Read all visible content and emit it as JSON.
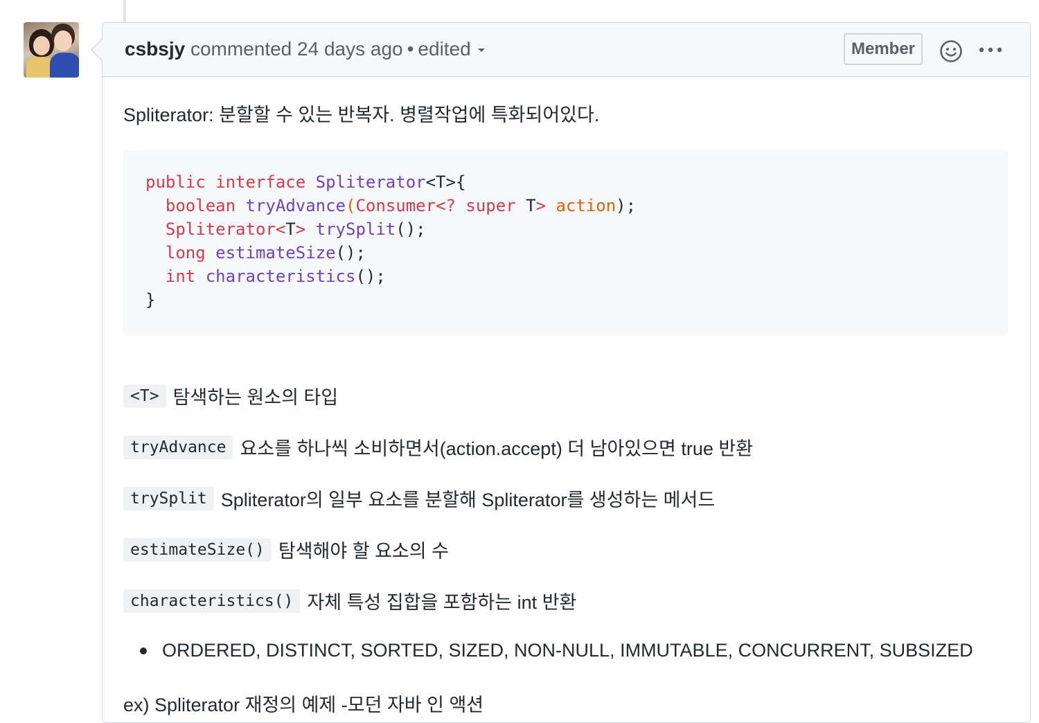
{
  "comment": {
    "author": "csbsjy",
    "action": "commented",
    "time": "24 days ago",
    "separator": "•",
    "edited": "edited",
    "badge": "Member"
  },
  "body": {
    "intro": "Spliterator: 분할할 수 있는 반복자. 병렬작업에 특화되어있다.",
    "code": {
      "line1": {
        "kw1": "public",
        "kw2": "interface",
        "name": "Spliterator",
        "rest": "<T>{"
      },
      "line2": {
        "kw": "boolean",
        "fn": "tryAdvance",
        "open": "(",
        "type": "Consumer<? super",
        "t": " T",
        "gt": ">",
        "param": "action",
        "close": ");"
      },
      "line3": {
        "kw": "Spliterator<",
        "t": "T",
        "gt": ">",
        "fn": "trySplit",
        "close": "();"
      },
      "line4": {
        "kw": "long",
        "fn": "estimateSize",
        "close": "();"
      },
      "line5": {
        "kw": "int",
        "fn": "characteristics",
        "close": "();"
      },
      "line6": "}"
    },
    "items": [
      {
        "code": "<T>",
        "text": "탐색하는 원소의 타입"
      },
      {
        "code": "tryAdvance",
        "text": "요소를 하나씩 소비하면서(action.accept) 더 남아있으면 true 반환"
      },
      {
        "code": "trySplit",
        "text": "Spliterator의 일부 요소를 분할해 Spliterator를 생성하는 메서드"
      },
      {
        "code": "estimateSize()",
        "text": "탐색해야 할 요소의 수"
      },
      {
        "code": "characteristics()",
        "text": "자체 특성 집합을 포함하는 int 반환"
      }
    ],
    "bullet": "ORDERED, DISTINCT, SORTED, SIZED, NON-NULL, IMMUTABLE, CONCURRENT, SUBSIZED",
    "example": "ex) Spliterator 재정의 예제 -모던 자바 인 액션"
  }
}
